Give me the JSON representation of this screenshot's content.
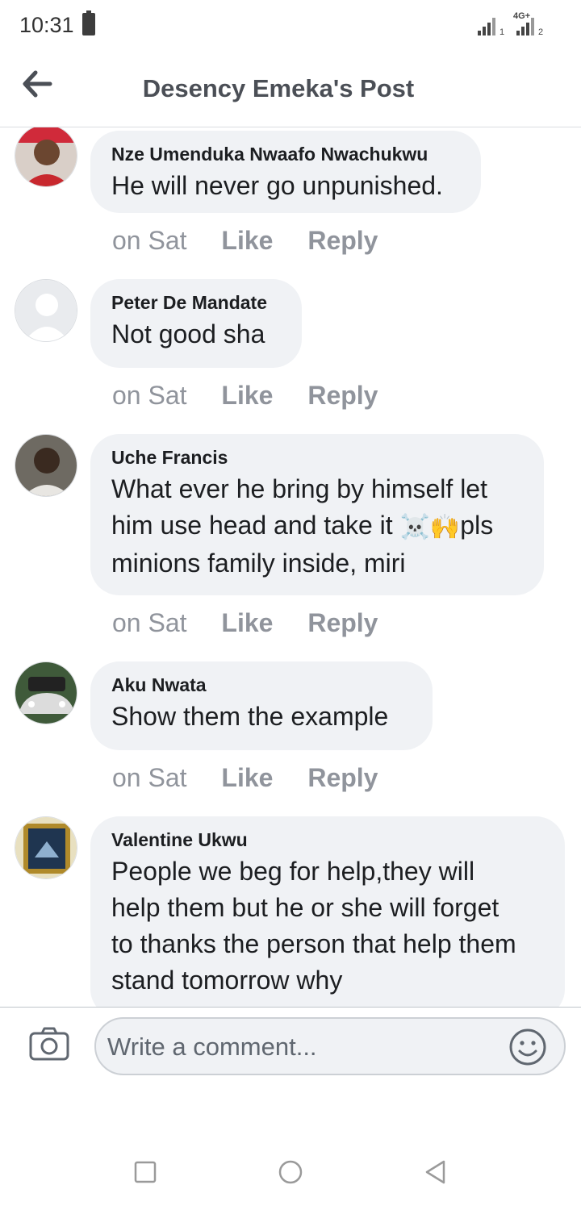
{
  "status_bar": {
    "time": "10:31",
    "network": "4G+",
    "sim1": "1",
    "sim2": "2"
  },
  "header": {
    "title": "Desency Emeka's Post",
    "back_icon": "arrow-left-icon"
  },
  "comments": [
    {
      "author": "Nze Umenduka Nwaafo Nwachukwu",
      "text": "He will never go unpunished.",
      "time": "on Sat",
      "like": "Like",
      "reply": "Reply"
    },
    {
      "author": "Peter De Mandate",
      "text": "Not good sha",
      "time": "on Sat",
      "like": "Like",
      "reply": "Reply"
    },
    {
      "author": "Uche Francis",
      "text_line1": "What ever he bring by himself let",
      "text_line2a": "him use head and take it ",
      "emoji1": "☠️",
      "emoji2": "🙌",
      "text_line2b": "pls",
      "text_line3": "minions family inside, miri",
      "time": "on Sat",
      "like": "Like",
      "reply": "Reply"
    },
    {
      "author": "Aku Nwata",
      "text": "Show them the example",
      "time": "on Sat",
      "like": "Like",
      "reply": "Reply"
    },
    {
      "author": "Valentine Ukwu",
      "text_line1": "People we beg for help,they will",
      "text_line2": "help them but he or she will forget",
      "text_line3": "to thanks the person that help them",
      "text_line4": "stand tomorrow why"
    }
  ],
  "composer": {
    "placeholder": "Write a comment...",
    "camera_icon": "camera-icon",
    "emoji_icon": "smiley-icon"
  },
  "nav": {
    "recents_icon": "square-icon",
    "home_icon": "circle-icon",
    "back_icon": "triangle-back-icon"
  },
  "colors": {
    "bubble": "#f0f2f5",
    "meta_text": "#90949c",
    "title": "#4b4f56"
  }
}
